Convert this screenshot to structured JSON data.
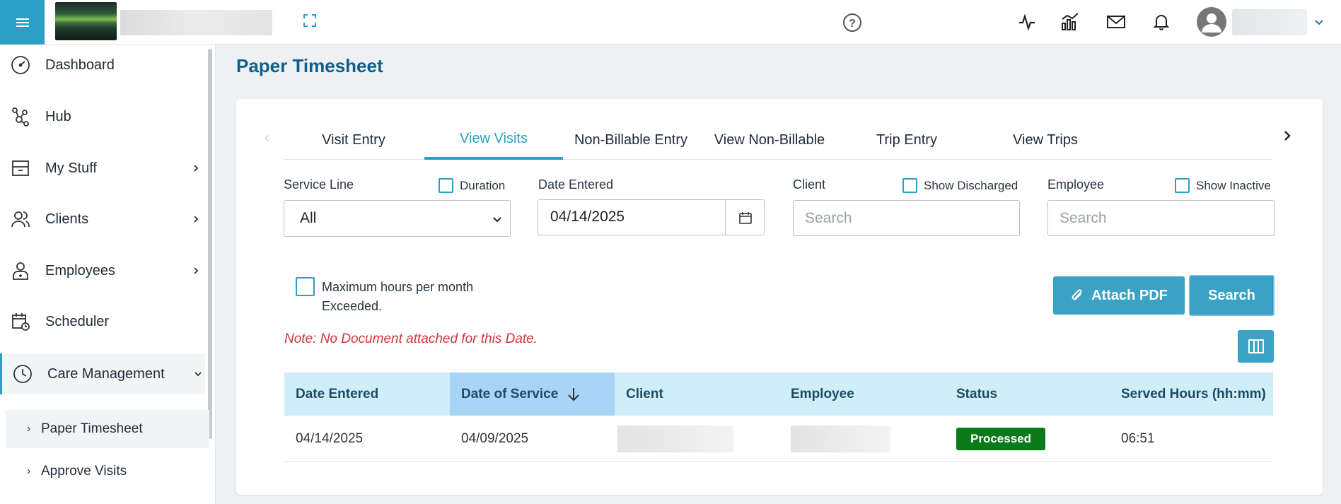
{
  "header": {
    "help_icon": "question-circle-icon",
    "icons": [
      "activity-pulse-icon",
      "analytics-chart-icon",
      "mail-icon",
      "bell-icon"
    ],
    "accent_color": "#2c9fc4"
  },
  "sidebar": {
    "items": [
      {
        "label": "Dashboard",
        "icon": "speedometer-icon",
        "has_chevron": false
      },
      {
        "label": "Hub",
        "icon": "hub-network-icon",
        "has_chevron": false
      },
      {
        "label": "My Stuff",
        "icon": "inbox-tray-icon",
        "has_chevron": true
      },
      {
        "label": "Clients",
        "icon": "users-icon",
        "has_chevron": true
      },
      {
        "label": "Employees",
        "icon": "employee-badge-icon",
        "has_chevron": true
      },
      {
        "label": "Scheduler",
        "icon": "calendar-clock-icon",
        "has_chevron": false
      },
      {
        "label": "Care Management",
        "icon": "clock-icon",
        "has_chevron": true,
        "expanded": true
      }
    ],
    "sub_items": [
      {
        "label": "Paper Timesheet",
        "active": true
      },
      {
        "label": "Approve Visits",
        "active": false
      }
    ]
  },
  "page": {
    "title": "Paper Timesheet"
  },
  "tabs": [
    {
      "label": "Visit Entry",
      "active": false
    },
    {
      "label": "View Visits",
      "active": true
    },
    {
      "label": "Non-Billable Entry",
      "active": false
    },
    {
      "label": "View Non-Billable",
      "active": false
    },
    {
      "label": "Trip Entry",
      "active": false
    },
    {
      "label": "View Trips",
      "active": false
    }
  ],
  "filters": {
    "service_line_label": "Service Line",
    "service_line_value": "All",
    "duration_label": "Duration",
    "date_entered_label": "Date Entered",
    "date_entered_value": "04/14/2025",
    "client_label": "Client",
    "client_placeholder": "Search",
    "show_discharged_label": "Show Discharged",
    "employee_label": "Employee",
    "employee_placeholder": "Search",
    "show_inactive_label": "Show Inactive",
    "max_hours_label": "Maximum hours per month Exceeded."
  },
  "actions": {
    "attach_pdf": "Attach PDF",
    "search": "Search"
  },
  "note": "Note: No Document attached for this Date.",
  "table": {
    "columns": [
      "Date Entered",
      "Date of Service",
      "Client",
      "Employee",
      "Status",
      "Served Hours (hh:mm)"
    ],
    "sorted_column": "Date of Service",
    "rows": [
      {
        "date_entered": "04/14/2025",
        "date_of_service": "04/09/2025",
        "client": "",
        "employee": "",
        "status": "Processed",
        "served_hours": "06:51"
      }
    ],
    "status_color": "#0a7a1a"
  }
}
